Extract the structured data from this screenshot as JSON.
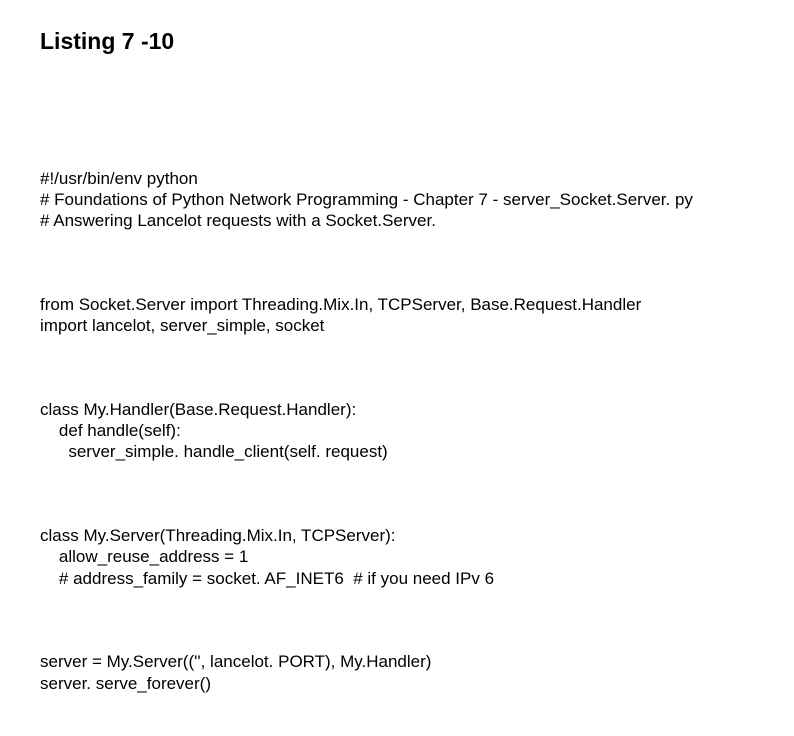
{
  "title": "Listing 7 -10",
  "paragraphs": [
    "#!/usr/bin/env python\n# Foundations of Python Network Programming - Chapter 7 - server_Socket.Server. py\n# Answering Lancelot requests with a Socket.Server.",
    "from Socket.Server import Threading.Mix.In, TCPServer, Base.Request.Handler\nimport lancelot, server_simple, socket",
    "class My.Handler(Base.Request.Handler):\n    def handle(self):\n      server_simple. handle_client(self. request)",
    "class My.Server(Threading.Mix.In, TCPServer):\n    allow_reuse_address = 1\n    # address_family = socket. AF_INET6  # if you need IPv 6",
    "server = My.Server(('', lancelot. PORT), My.Handler)\nserver. serve_forever()"
  ]
}
